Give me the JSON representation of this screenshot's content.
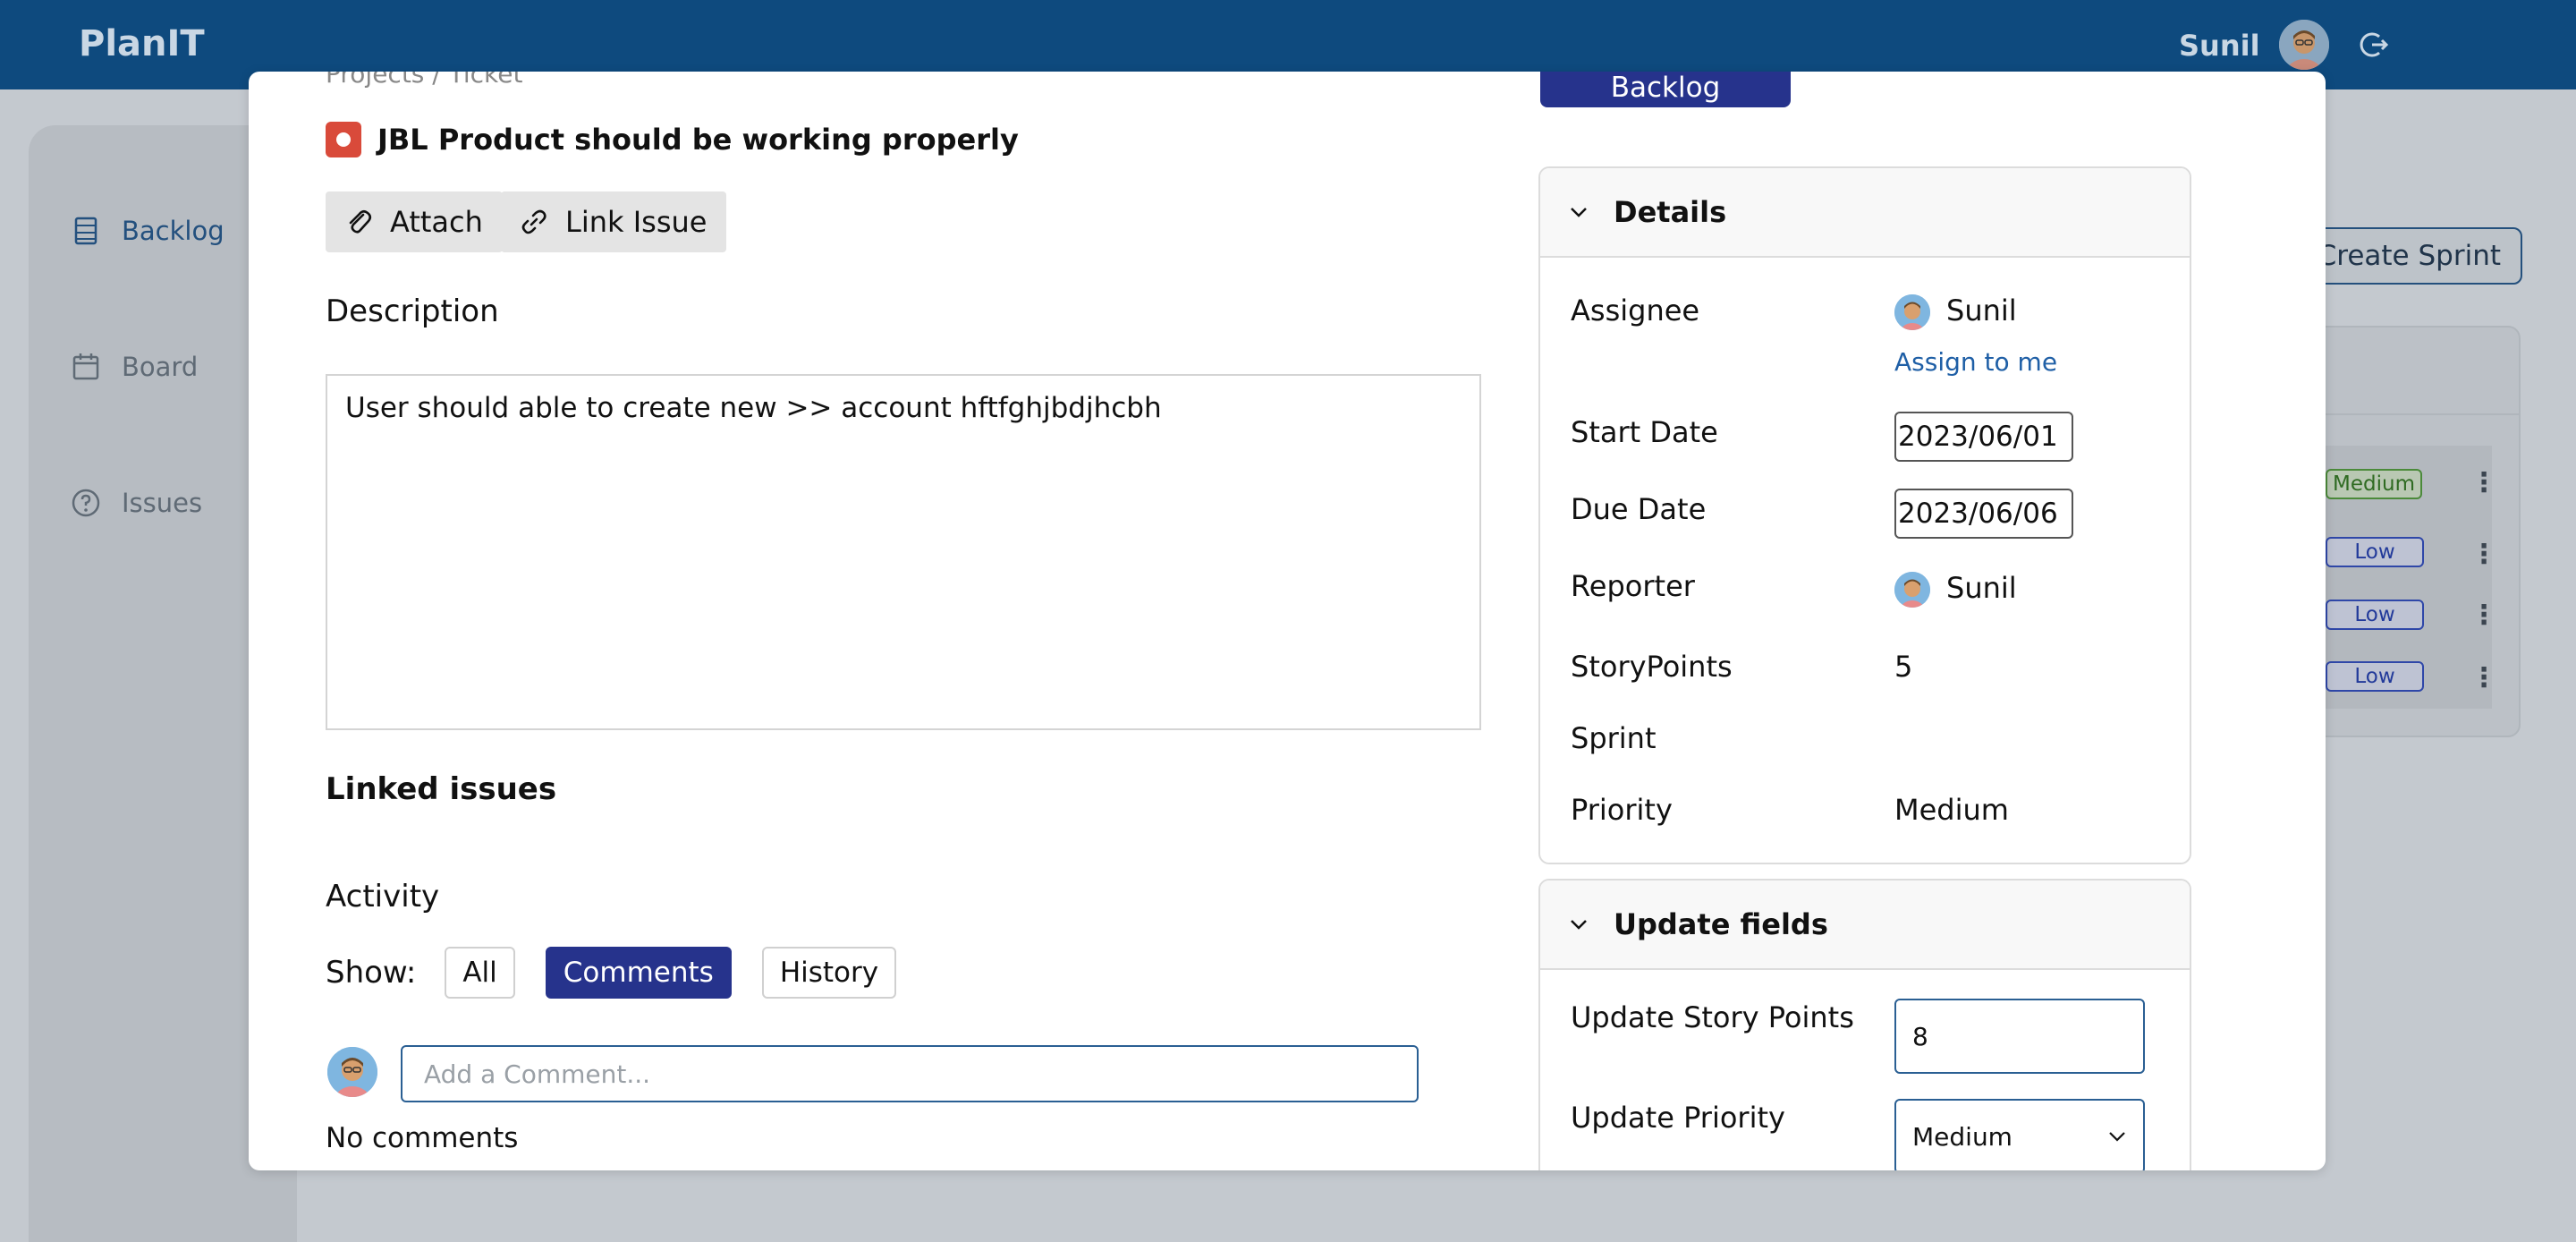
{
  "app": {
    "brand": "PlanIT",
    "user_name": "Sunil"
  },
  "sidebar": {
    "items": [
      {
        "label": "Backlog",
        "icon": "backlog-icon",
        "active": true
      },
      {
        "label": "Board",
        "icon": "calendar-icon",
        "active": false
      },
      {
        "label": "Issues",
        "icon": "help-circle-icon",
        "active": false
      }
    ]
  },
  "background": {
    "create_sprint_label": "Create Sprint",
    "priorities": [
      "Medium",
      "Low",
      "Low",
      "Low"
    ]
  },
  "modal": {
    "status_button": "Backlog",
    "issue_title": "JBL Product should be working properly",
    "attach_label": "Attach",
    "link_issue_label": "Link Issue",
    "description_heading": "Description",
    "description_text": "User should able to create new >> account hftfghjbdjhcbh",
    "linked_issues_heading": "Linked issues",
    "activity_heading": "Activity",
    "show_label": "Show:",
    "filters": [
      "All",
      "Comments",
      "History"
    ],
    "active_filter": "Comments",
    "comment_placeholder": "Add a Comment...",
    "no_comments": "No comments"
  },
  "details": {
    "heading": "Details",
    "assignee_label": "Assignee",
    "assignee": "Sunil",
    "assign_to_me": "Assign to me",
    "start_date_label": "Start Date",
    "start_date": "2023/06/01",
    "due_date_label": "Due Date",
    "due_date": "2023/06/06",
    "reporter_label": "Reporter",
    "reporter": "Sunil",
    "story_points_label": "StoryPoints",
    "story_points": "5",
    "sprint_label": "Sprint",
    "sprint": "",
    "priority_label": "Priority",
    "priority": "Medium"
  },
  "update_fields": {
    "heading": "Update fields",
    "story_points_label": "Update Story Points",
    "story_points_value": "8",
    "priority_label": "Update Priority",
    "priority_value": "Medium"
  },
  "colors": {
    "topbar": "#0e4a7e",
    "primary": "#26338c",
    "link": "#1f5fa6",
    "bug": "#d94a3a"
  }
}
